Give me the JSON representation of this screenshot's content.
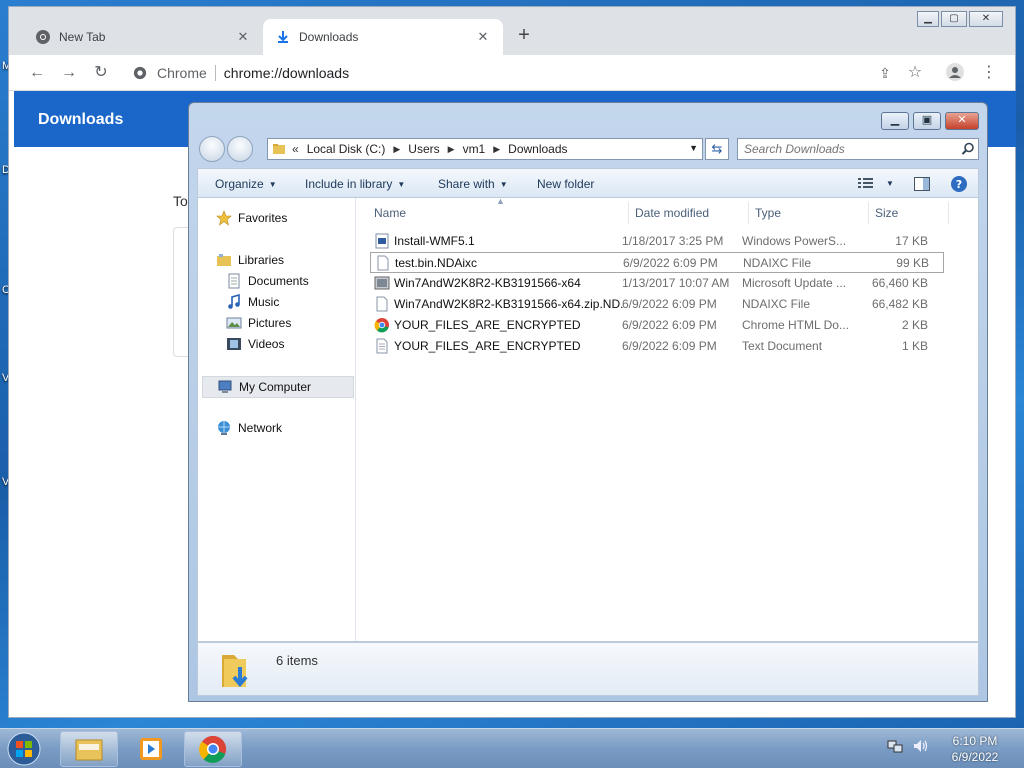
{
  "desktop": {
    "fragments": [
      "M",
      "D",
      "C",
      "V",
      "V"
    ]
  },
  "chrome": {
    "tabs": [
      {
        "title": "New Tab",
        "icon": "chrome-icon",
        "active": false
      },
      {
        "title": "Downloads",
        "icon": "download-icon",
        "active": true
      }
    ],
    "new_tab": "+",
    "omnibox": {
      "site_label": "Chrome",
      "url": "chrome://downloads"
    },
    "page": {
      "title": "Downloads",
      "fragment_text": "To"
    }
  },
  "explorer": {
    "breadcrumbs": [
      "Local Disk (C:)",
      "Users",
      "vm1",
      "Downloads"
    ],
    "breadcrumb_overflow": "«",
    "search_placeholder": "Search Downloads",
    "commands": [
      {
        "label": "Organize",
        "has_menu": true
      },
      {
        "label": "Include in library",
        "has_menu": true
      },
      {
        "label": "Share with",
        "has_menu": true
      },
      {
        "label": "New folder",
        "has_menu": false
      }
    ],
    "nav": {
      "favorites": "Favorites",
      "libraries": "Libraries",
      "library_items": [
        "Documents",
        "Music",
        "Pictures",
        "Videos"
      ],
      "my_computer": "My Computer",
      "network": "Network"
    },
    "columns": {
      "name": "Name",
      "date": "Date modified",
      "type": "Type",
      "size": "Size"
    },
    "files": [
      {
        "name": "Install-WMF5.1",
        "date": "1/18/2017 3:25 PM",
        "type": "Windows PowerS...",
        "size": "17 KB",
        "icon": "powershell-script-icon"
      },
      {
        "name": "test.bin.NDAixc",
        "date": "6/9/2022 6:09 PM",
        "type": "NDAIXC File",
        "size": "99 KB",
        "icon": "blank-file-icon",
        "selected": true
      },
      {
        "name": "Win7AndW2K8R2-KB3191566-x64",
        "date": "1/13/2017 10:07 AM",
        "type": "Microsoft Update ...",
        "size": "66,460 KB",
        "icon": "update-package-icon"
      },
      {
        "name": "Win7AndW2K8R2-KB3191566-x64.zip.ND...",
        "date": "6/9/2022 6:09 PM",
        "type": "NDAIXC File",
        "size": "66,482 KB",
        "icon": "blank-file-icon"
      },
      {
        "name": "YOUR_FILES_ARE_ENCRYPTED",
        "date": "6/9/2022 6:09 PM",
        "type": "Chrome HTML Do...",
        "size": "2 KB",
        "icon": "chrome-icon"
      },
      {
        "name": "YOUR_FILES_ARE_ENCRYPTED",
        "date": "6/9/2022 6:09 PM",
        "type": "Text Document",
        "size": "1 KB",
        "icon": "text-file-icon"
      }
    ],
    "item_count": "6 items"
  },
  "taskbar": {
    "clock_time": "6:10 PM",
    "clock_date": "6/9/2022"
  }
}
